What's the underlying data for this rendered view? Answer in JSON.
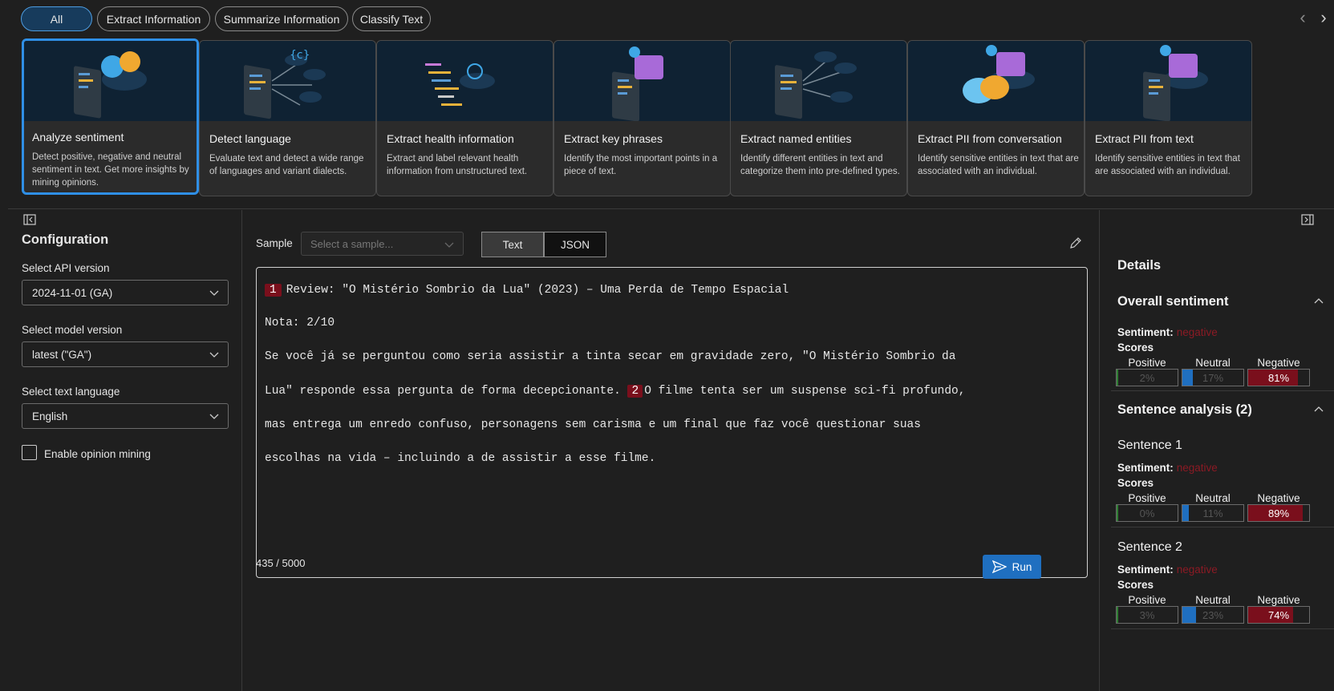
{
  "filters": [
    "All",
    "Extract Information",
    "Summarize Information",
    "Classify Text"
  ],
  "cards": [
    {
      "title": "Analyze sentiment",
      "desc": "Detect positive, negative and neutral sentiment in text. Get more insights by mining opinions.",
      "icon": "sentiment-art"
    },
    {
      "title": "Detect language",
      "desc": "Evaluate text and detect a wide range of languages and variant dialects.",
      "icon": "language-art"
    },
    {
      "title": "Extract health information",
      "desc": "Extract and label relevant health information from unstructured text.",
      "icon": "health-art"
    },
    {
      "title": "Extract key phrases",
      "desc": "Identify the most important points in a piece of text.",
      "icon": "key-phrases-art"
    },
    {
      "title": "Extract named entities",
      "desc": "Identify different entities in text and categorize them into pre-defined types.",
      "icon": "entities-art"
    },
    {
      "title": "Extract PII from conversation",
      "desc": "Identify sensitive entities in text that are associated with an individual.",
      "icon": "pii-conversation-art"
    },
    {
      "title": "Extract PII from text",
      "desc": "Identify sensitive entities in text that are associated with an individual.",
      "icon": "pii-text-art"
    }
  ],
  "config": {
    "title": "Configuration",
    "api_label": "Select API version",
    "api_value": "2024-11-01 (GA)",
    "model_label": "Select model version",
    "model_value": "latest (\"GA\")",
    "lang_label": "Select text language",
    "lang_value": "English",
    "opinion_label": "Enable opinion mining"
  },
  "editor": {
    "sample_label": "Sample",
    "sample_placeholder": "Select a sample...",
    "tab_text": "Text",
    "tab_json": "JSON",
    "marker1": "1",
    "marker2": "2",
    "line1": "Review: \"O Mistério Sombrio da Lua\" (2023) – Uma Perda de Tempo Espacial",
    "line2": "Nota: 2/10",
    "line3": "Se você já se perguntou como seria assistir a tinta secar em gravidade zero, \"O Mistério Sombrio da",
    "line4a": "Lua\" responde essa pergunta de forma decepcionante.",
    "line4b": "O filme tenta ser um suspense sci-fi profundo,",
    "line5": "mas entrega um enredo confuso, personagens sem carisma e um final que faz você questionar suas",
    "line6": "escolhas na vida – incluindo a de assistir a esse filme.",
    "count": "435 / 5000",
    "run": "Run"
  },
  "details": {
    "title": "Details",
    "overall_title": "Overall sentiment",
    "sentiment_label": "Sentiment:",
    "sentiment_value": "negative",
    "scores_label": "Scores",
    "cols": [
      "Positive",
      "Neutral",
      "Negative"
    ],
    "overall": {
      "positive": "2%",
      "neutral": "17%",
      "negative": "81%",
      "p": 0.02,
      "n": 0.17,
      "g": 0.81
    },
    "sentence_title": "Sentence analysis (2)",
    "sentences": [
      {
        "name": "Sentence 1",
        "positive": "0%",
        "neutral": "11%",
        "negative": "89%",
        "p": 0.0,
        "n": 0.11,
        "g": 0.89
      },
      {
        "name": "Sentence 2",
        "positive": "3%",
        "neutral": "23%",
        "negative": "74%",
        "p": 0.03,
        "n": 0.23,
        "g": 0.74
      }
    ]
  },
  "colors": {
    "accent": "#2f8fe6",
    "negative": "#7a0f1c",
    "neutral": "#1f6fc0",
    "positive": "#2e7d32"
  }
}
